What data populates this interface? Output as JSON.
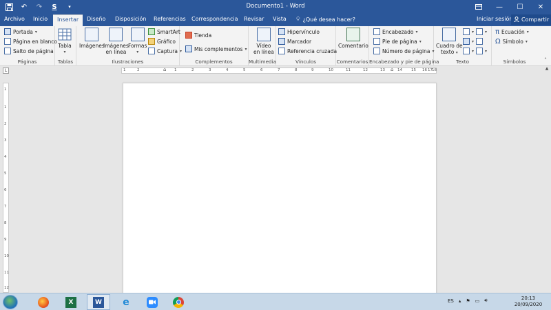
{
  "window": {
    "title": "Documento1  -  Word",
    "minimize_icon": "minimize-icon",
    "maximize_icon": "maximize-icon",
    "close_icon": "close-icon"
  },
  "qat": [
    "save-icon",
    "undo-icon",
    "redo-icon",
    "styles-icon",
    "customize-icon"
  ],
  "tabs": [
    "Archivo",
    "Inicio",
    "Insertar",
    "Diseño",
    "Disposición",
    "Referencias",
    "Correspondencia",
    "Revisar",
    "Vista"
  ],
  "active_tab": "Insertar",
  "tell_me": "¿Qué desea hacer?",
  "sign_in": "Iniciar sesión",
  "share": "Compartir",
  "ribbon": {
    "paginas": {
      "label": "Páginas",
      "items": [
        "Portada",
        "Página en blanco",
        "Salto de página"
      ]
    },
    "tablas": {
      "label": "Tablas",
      "table": "Tabla"
    },
    "ilustraciones": {
      "label": "Ilustraciones",
      "imagenes": "Imágenes",
      "imagenes_linea_1": "Imágenes",
      "imagenes_linea_2": "en línea",
      "formas": "Formas",
      "smartart": "SmartArt",
      "grafico": "Gráfico",
      "captura": "Captura"
    },
    "complementos": {
      "label": "Complementos",
      "tienda": "Tienda",
      "mis": "Mis complementos"
    },
    "multimedia": {
      "label": "Multimedia",
      "video_1": "Vídeo",
      "video_2": "en línea"
    },
    "vinculos": {
      "label": "Vínculos",
      "items": [
        "Hipervínculo",
        "Marcador",
        "Referencia cruzada"
      ]
    },
    "comentarios": {
      "label": "Comentarios",
      "comentario": "Comentario"
    },
    "encabezado": {
      "label": "Encabezado y pie de página",
      "items": [
        "Encabezado",
        "Pie de página",
        "Número de página"
      ]
    },
    "texto": {
      "label": "Texto",
      "cuadro_1": "Cuadro de",
      "cuadro_2": "texto"
    },
    "simbolos": {
      "label": "Símbolos",
      "ecuacion": "Ecuación",
      "simbolo": "Símbolo"
    }
  },
  "ruler_numbers": [
    "1",
    "2",
    "1",
    "2",
    "3",
    "4",
    "5",
    "6",
    "7",
    "8",
    "9",
    "10",
    "11",
    "12",
    "13",
    "14",
    "15",
    "16",
    "17",
    "18"
  ],
  "vruler_numbers": [
    "1",
    "1",
    "2",
    "3",
    "4",
    "5",
    "6",
    "7",
    "8",
    "9",
    "10",
    "11",
    "12"
  ],
  "taskbar": {
    "apps": [
      "Firefox",
      "Excel",
      "Word",
      "Internet Explorer",
      "Zoom",
      "Chrome"
    ],
    "active_app": "Word",
    "language": "ES",
    "time": "20:13",
    "date": "20/09/2020"
  }
}
